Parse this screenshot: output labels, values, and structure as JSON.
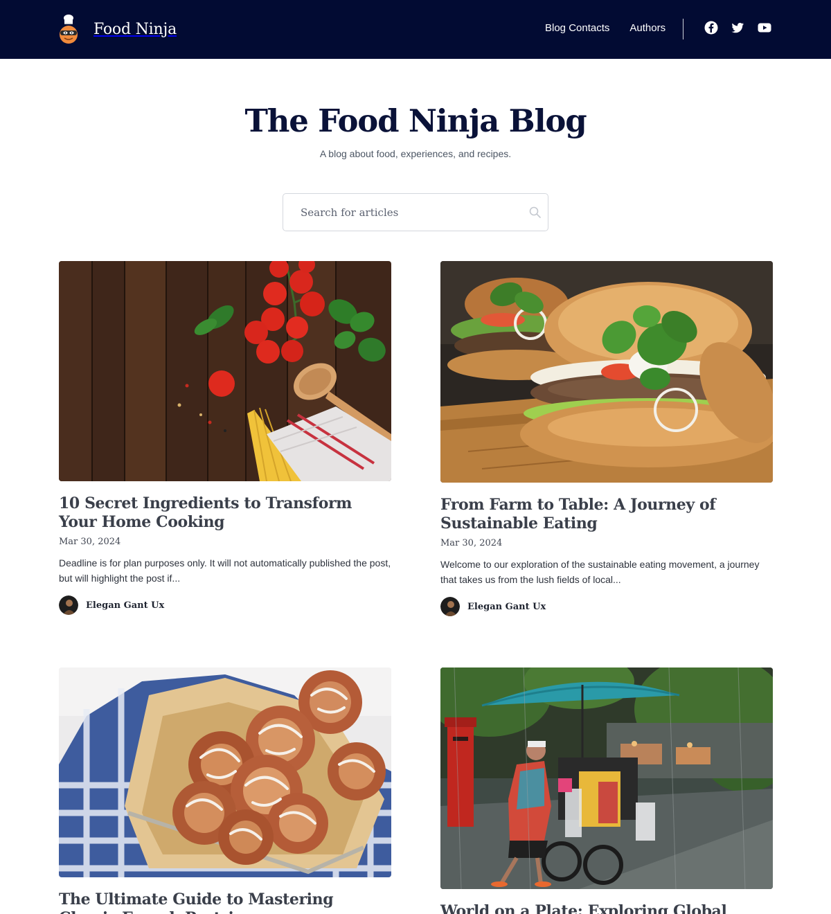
{
  "header": {
    "brand": "Food Ninja",
    "nav": [
      "Blog Contacts",
      "Authors"
    ],
    "social": [
      "facebook-icon",
      "twitter-icon",
      "youtube-icon"
    ],
    "background": "#020b33"
  },
  "hero": {
    "title": "The Food Ninja Blog",
    "subtitle": "A blog about food, experiences, and recipes."
  },
  "search": {
    "placeholder": "Search for articles",
    "value": ""
  },
  "posts": [
    {
      "title": "10 Secret Ingredients to Transform Your Home Cooking",
      "date": "Mar 30, 2024",
      "excerpt": "Deadline is for plan purposes only. It will not automatically published the post, but will highlight the post if...",
      "author": "Elegan Gant Ux"
    },
    {
      "title": "From Farm to Table: A Journey of Sustainable Eating",
      "date": "Mar 30, 2024",
      "excerpt": "Welcome to our exploration of the sustainable eating movement, a journey that takes us from the lush fields of local...",
      "author": "Elegan Gant Ux"
    },
    {
      "title": "The Ultimate Guide to Mastering Classic French Pastries",
      "date": "",
      "excerpt": "",
      "author": ""
    },
    {
      "title": "World on a Plate: Exploring Global Street",
      "date": "",
      "excerpt": "",
      "author": ""
    }
  ]
}
